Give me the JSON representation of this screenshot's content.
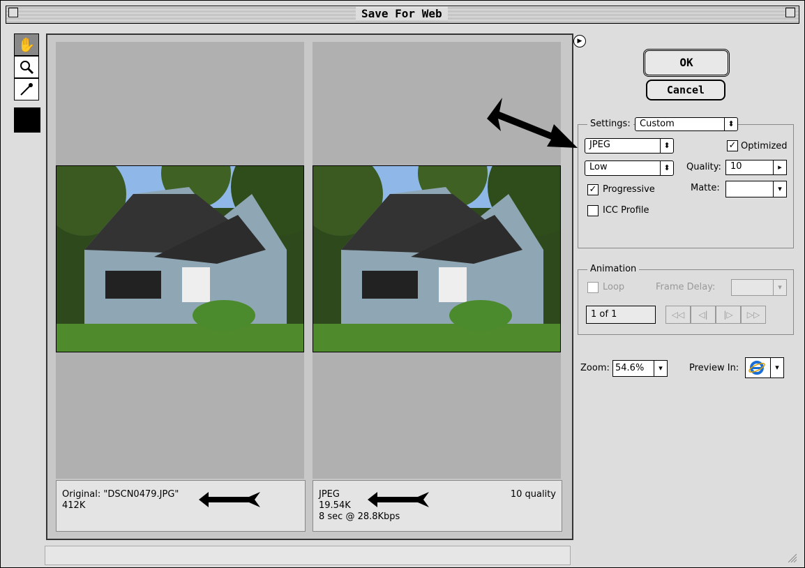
{
  "window": {
    "title": "Save For Web"
  },
  "toolbar": {
    "tools": [
      "hand-icon",
      "zoom-icon",
      "eyedropper-icon"
    ],
    "color_swatch": "#000000"
  },
  "original": {
    "label": "Original: \"DSCN0479.JPG\"",
    "size": "412K"
  },
  "optimized": {
    "format": "JPEG",
    "size": "19.54K",
    "download": "8 sec @ 28.8Kbps",
    "quality_note": "10 quality"
  },
  "buttons": {
    "ok": "OK",
    "cancel": "Cancel"
  },
  "settings": {
    "label": "Settings:",
    "preset": "Custom",
    "format": "JPEG",
    "optimized_label": "Optimized",
    "optimized": true,
    "quality_level": "Low",
    "quality_label": "Quality:",
    "quality_value": "10",
    "progressive_label": "Progressive",
    "progressive": true,
    "matte_label": "Matte:",
    "icc_label": "ICC Profile",
    "icc": false
  },
  "animation": {
    "label": "Animation",
    "loop_label": "Loop",
    "frame_delay_label": "Frame Delay:",
    "frame_counter": "1 of 1"
  },
  "zoom": {
    "label": "Zoom:",
    "value": "54.6%"
  },
  "preview_in": {
    "label": "Preview In:",
    "browser_icon": "ie-icon"
  },
  "colors": {
    "window_bg": "#dddddd",
    "pane_bg": "#b0b0b0",
    "ie_blue": "#1a6fd6"
  }
}
